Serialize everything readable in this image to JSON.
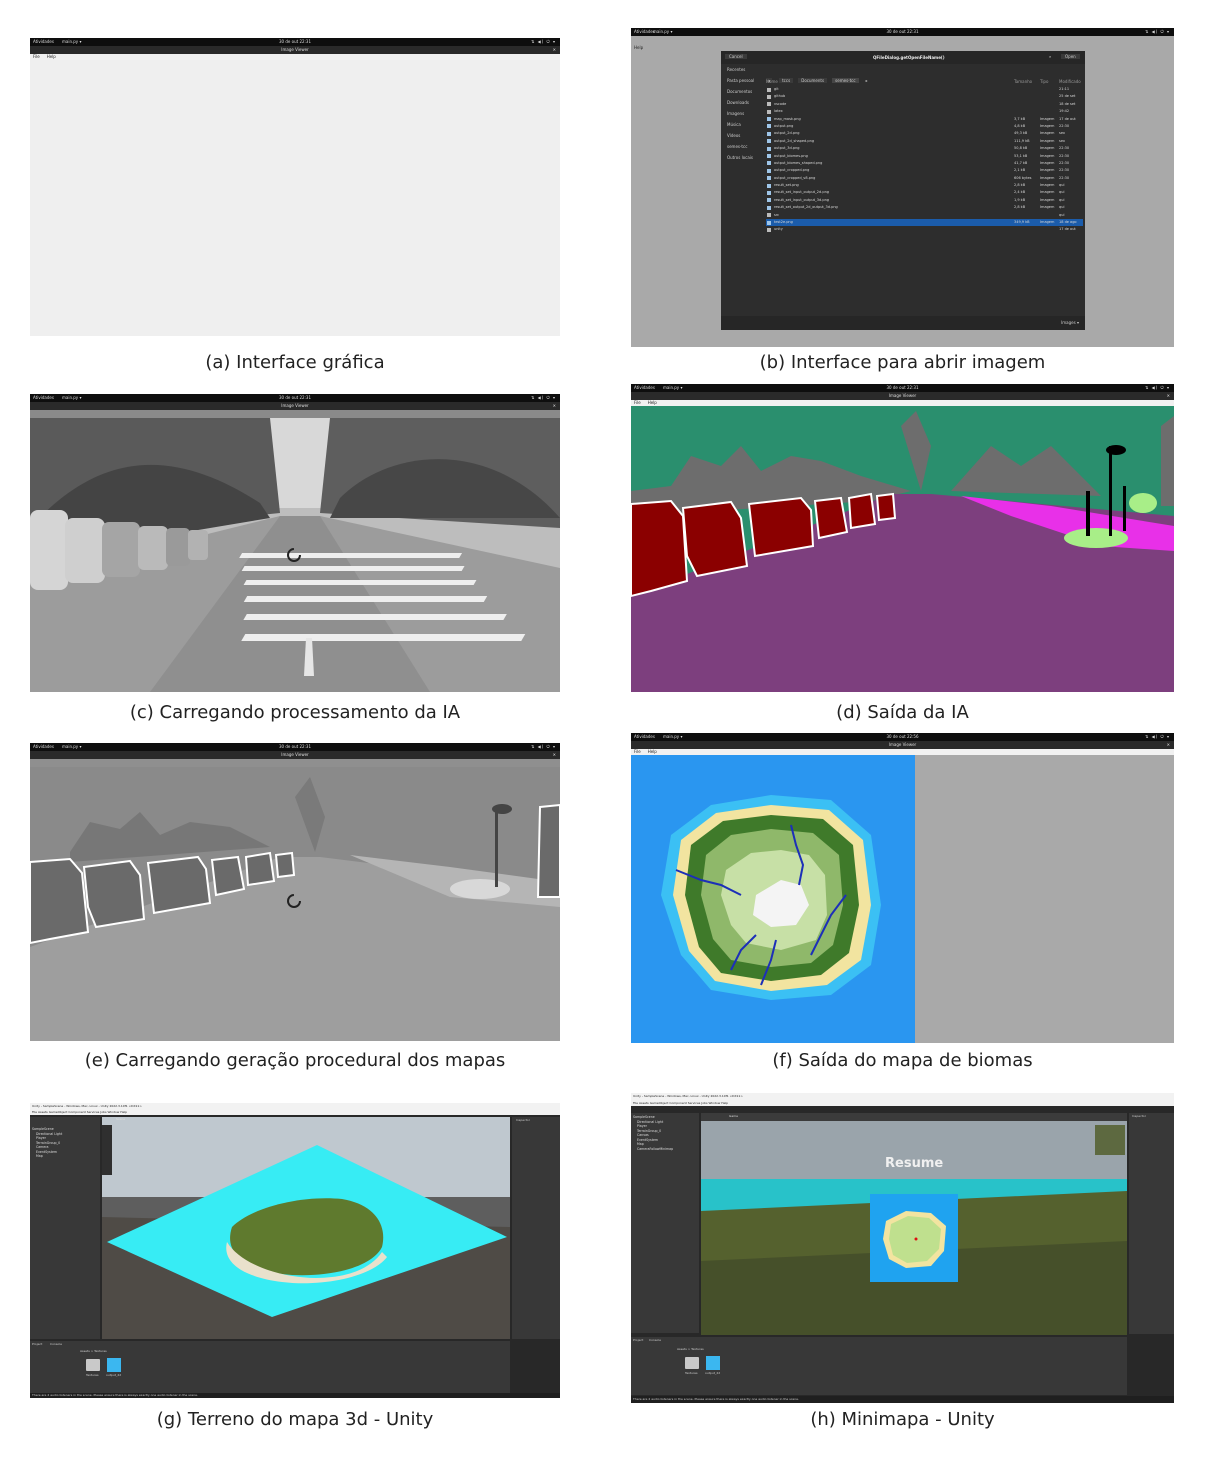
{
  "captions": {
    "a": "(a) Interface gráfica",
    "b": "(b) Interface para abrir imagem",
    "c": "(c) Carregando processamento da IA",
    "d": "(d) Saída da IA",
    "e": "(e) Carregando geração procedural dos mapas",
    "f": "(f) Saída do mapa de biomas",
    "g": "(g) Terreno do mapa 3d - Unity",
    "h": "(h) Minimapa - Unity"
  },
  "gnome": {
    "activities": "Atividades",
    "app": "main.py ▾",
    "clock": "30 de out 22:31",
    "clock_f": "30 de out 22:56",
    "tray": "⇅ ◀) ⏻ ▾"
  },
  "window": {
    "title": "Image Viewer",
    "close": "✕",
    "menu_file": "File",
    "menu_help": "Help"
  },
  "dialog": {
    "cancel": "Cancel",
    "title": "QFileDialog.getOpenFileName()",
    "open": "Open",
    "path": [
      "tccs",
      "Documents",
      "semes-tcc"
    ],
    "sidebar": [
      "Recentes",
      "Pasta pessoal",
      "Documentos",
      "Downloads",
      "Imagens",
      "Música",
      "Vídeos",
      "semes-tcc",
      "Outros locais"
    ],
    "columns": [
      "Nome",
      "Tamanho",
      "Tipo",
      "Modificado"
    ],
    "files": [
      [
        "git",
        "",
        "",
        "21:11"
      ],
      [
        "github",
        "",
        "",
        "25 de set"
      ],
      [
        "vscode",
        "",
        "",
        "18 de set"
      ],
      [
        "latex",
        "",
        "",
        "19:42"
      ],
      [
        "map_mask.png",
        "3,7 kB",
        "Imagem",
        "17 de out"
      ],
      [
        "output.png",
        "4,8 kB",
        "Imagem",
        "22:30"
      ],
      [
        "output_2d.png",
        "49,3 kB",
        "Imagem",
        "sex"
      ],
      [
        "output_2d_shaped.png",
        "111,9 kB",
        "Imagem",
        "sex"
      ],
      [
        "output_3d.png",
        "50,8 kB",
        "Imagem",
        "22:30"
      ],
      [
        "output_biomes.png",
        "53,1 kB",
        "Imagem",
        "22:30"
      ],
      [
        "output_biomes_shaped.png",
        "41,7 kB",
        "Imagem",
        "22:30"
      ],
      [
        "output_cropped.png",
        "2,1 kB",
        "Imagem",
        "22:30"
      ],
      [
        "output_cropped_v8.png",
        "606 bytes",
        "Imagem",
        "22:30"
      ],
      [
        "result_set.png",
        "2,8 kB",
        "Imagem",
        "qui"
      ],
      [
        "result_set_input_output_2d.png",
        "2,4 kB",
        "Imagem",
        "qui"
      ],
      [
        "result_set_input_output_3d.png",
        "1,9 kB",
        "Imagem",
        "qui"
      ],
      [
        "result_set_output_2d_output_3d.png",
        "2,8 kB",
        "Imagem",
        "qui"
      ],
      [
        "src",
        "",
        "",
        "qui"
      ],
      [
        "test2e.png",
        "349,9 kB",
        "Imagem",
        "18 de ago"
      ],
      [
        "unity",
        "",
        "",
        "17 de out"
      ]
    ],
    "filter": "Images ▾"
  },
  "unity": {
    "title_g": "Unity - SampleScene - Windows, Mac, Linux - Unity 2022.3.10f1 <DX11>",
    "title_h": "Unity - SampleScene - Windows, Mac, Linux - Unity 2022.3.10f1 <DX11>",
    "menu": "File  Assets  GameObject  Component  Services  Jobs  Window  Help",
    "hierarchy": [
      "SampleScene",
      "Directional Light",
      "Player",
      "TerrainGroup_0",
      "Camera",
      "EventSystem",
      "Map"
    ],
    "hierarchy_h": [
      "SampleScene",
      "Directional Light",
      "Player",
      "TerrainGroup_0",
      "Canvas",
      "EventSystem",
      "Map",
      "CameraFollowMinimap"
    ],
    "tab_scene": "Scene",
    "tab_game": "Game",
    "tab_inspector": "Inspector",
    "tab_project": "Project",
    "tab_console": "Console",
    "assets_path": "Assets > Textures",
    "asset_folder": "Textures",
    "asset_file": "output_2d",
    "status": "There are 2 audio listeners in the scene. Please ensure there is always exactly one audio listener in the scene.",
    "resume": "Resume"
  },
  "colors": {
    "seg_green": "#2a8f6e",
    "seg_road": "#7d3f7e",
    "seg_car": "#8b0000",
    "seg_magenta": "#e830e8",
    "seg_lightgreen": "#a8ee88",
    "ocean": "#2a96f0",
    "unity_water": "#37ecf4"
  }
}
